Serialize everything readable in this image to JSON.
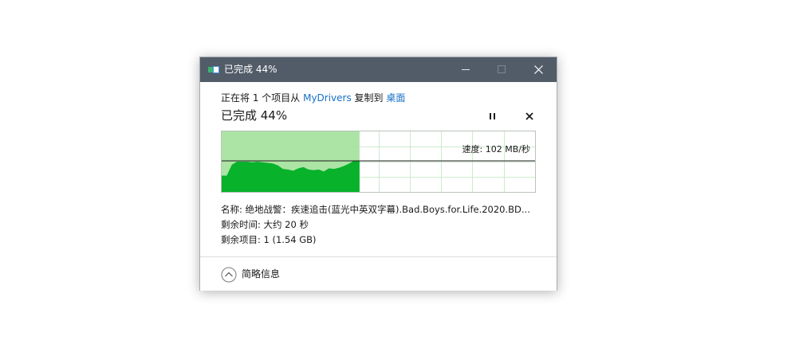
{
  "window": {
    "title": "已完成 44%",
    "titlebar_color": "#525c69"
  },
  "copy": {
    "prefix": "正在将 1 个项目从 ",
    "source": "MyDrivers",
    "middle": " 复制到 ",
    "destination": "桌面",
    "status": "已完成 44%",
    "percent_complete": 44
  },
  "graph": {
    "speed_text": "速度: 102 MB/秒",
    "progress_fraction": 0.44,
    "fill_color": "#a8e3a0",
    "area_color": "#08b22b",
    "speed_history_fraction": [
      0.27,
      0.27,
      0.45,
      0.5,
      0.5,
      0.5,
      0.49,
      0.5,
      0.49,
      0.48,
      0.47,
      0.44,
      0.38,
      0.37,
      0.35,
      0.39,
      0.41,
      0.37,
      0.36,
      0.37,
      0.34,
      0.39,
      0.38,
      0.4,
      0.43,
      0.47,
      0.52,
      0.52
    ],
    "current_speed_fraction": 0.52
  },
  "details": {
    "name_line": "名称: 绝地战警：疾速追击(蓝光中英双字幕).Bad.Boys.for.Life.2020.BD...",
    "time_line": "剩余时间: 大约 20 秒",
    "items_line": "剩余项目: 1 (1.54 GB)"
  },
  "footer": {
    "less_details_label": "简略信息"
  },
  "icons": {
    "app": "file-copy-icon",
    "pause": "pause-icon",
    "stop": "close-icon",
    "less": "chevron-up-circle-icon"
  }
}
